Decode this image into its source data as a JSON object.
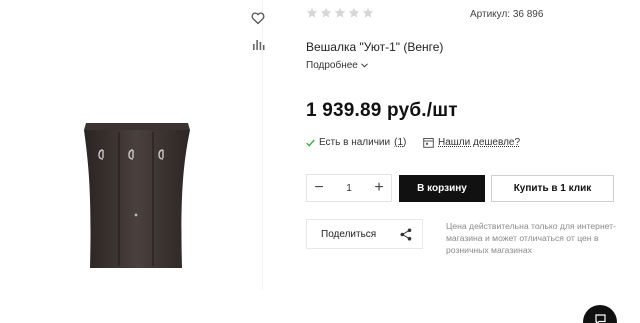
{
  "product": {
    "sku_label": "Артикул:",
    "sku_value": "36 896",
    "title": "Вешалка \"Уют-1\" (Венге)",
    "more_label": "Подробнее",
    "price": "1 939.89 руб./шт",
    "rating_stars": 0,
    "rating_max": 5
  },
  "stock": {
    "label": "Есть в наличии",
    "count": "(1)"
  },
  "cheaper": {
    "label": "Нашли дешевле?"
  },
  "quantity": {
    "minus": "−",
    "value": "1",
    "plus": "+"
  },
  "actions": {
    "to_cart": "В корзину",
    "one_click": "Купить в 1 клик",
    "share": "Поделиться"
  },
  "note": "Цена действительна только для интернет-магазина и может отличаться от цен в розничных магазинах",
  "colors": {
    "accent": "#111111",
    "stock_check": "#3fae49",
    "star_empty": "#d7d7d7",
    "muted": "#8a8a8a"
  },
  "icons": {
    "favorite": "heart-icon",
    "compare": "bar-chart-icon",
    "share": "share-icon",
    "stock": "check-icon",
    "cheaper": "calendar-tag-icon",
    "fab": "chat-icon"
  }
}
